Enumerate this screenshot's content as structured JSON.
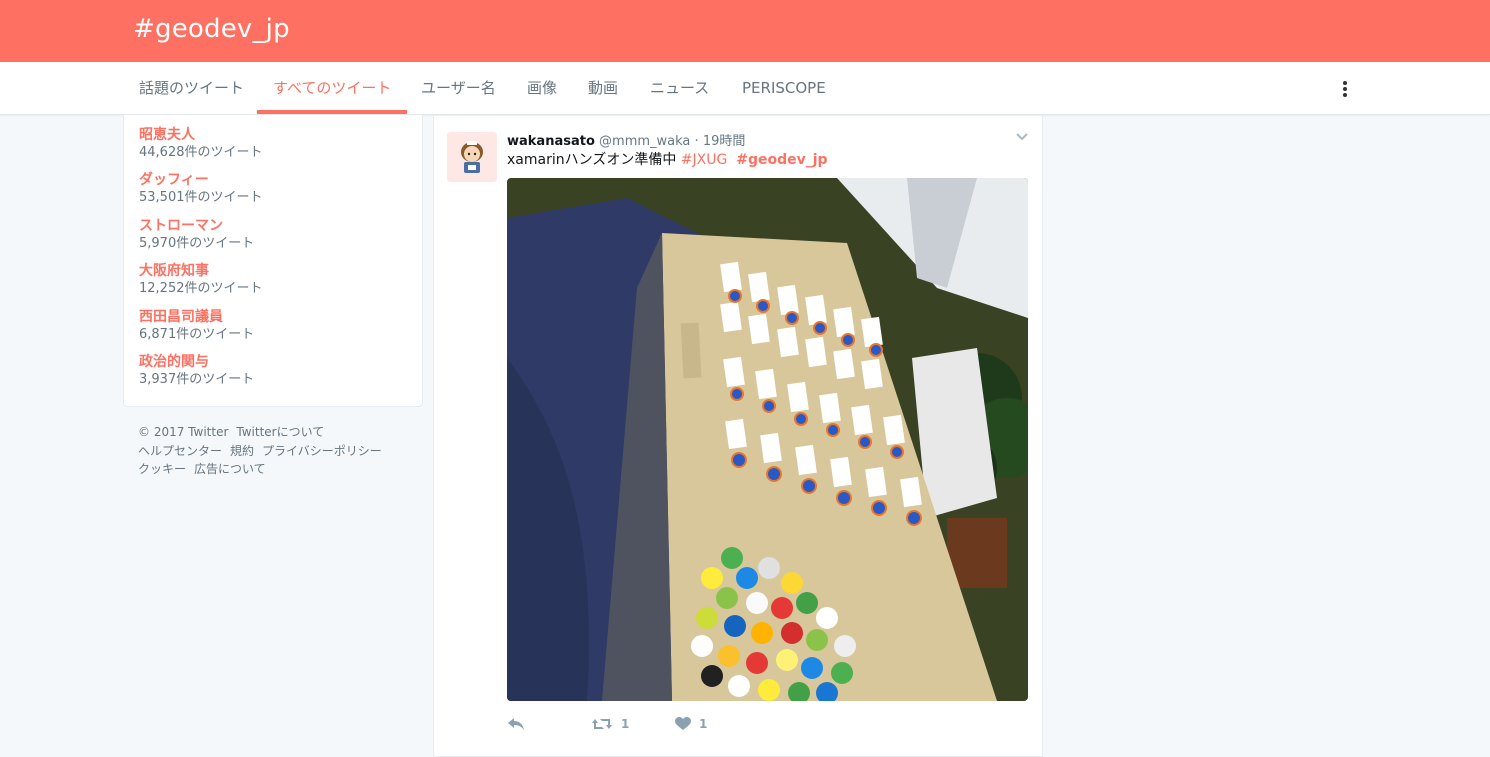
{
  "header": {
    "title": "#geodev_jp"
  },
  "nav": {
    "tabs": [
      {
        "label": "話題のツイート",
        "active": false
      },
      {
        "label": "すべてのツイート",
        "active": true
      },
      {
        "label": "ユーザー名",
        "active": false
      },
      {
        "label": "画像",
        "active": false
      },
      {
        "label": "動画",
        "active": false
      },
      {
        "label": "ニュース",
        "active": false
      },
      {
        "label": "PERISCOPE",
        "active": false
      }
    ]
  },
  "trends": [
    {
      "name": "昭恵夫人",
      "count": "44,628件のツイート"
    },
    {
      "name": "ダッフィー",
      "count": "53,501件のツイート"
    },
    {
      "name": "ストローマン",
      "count": "5,970件のツイート"
    },
    {
      "name": "大阪府知事",
      "count": "12,252件のツイート"
    },
    {
      "name": "西田昌司議員",
      "count": "6,871件のツイート"
    },
    {
      "name": "政治的関与",
      "count": "3,937件のツイート"
    }
  ],
  "footer": {
    "copyright": "© 2017 Twitter",
    "about": "Twitterについて",
    "help": "ヘルプセンター",
    "terms": "規約",
    "privacy": "プライバシーポリシー",
    "cookies": "クッキー",
    "ads": "広告について"
  },
  "tweet": {
    "username": "wakanasato",
    "handle": "@mmm_waka",
    "separator": "·",
    "time": "19時間",
    "text": "xamarinハンズオン準備中 ",
    "hashtag1": "#JXUG",
    "hashtag2": "#geodev_jp",
    "retweet_count": "1",
    "like_count": "1"
  },
  "colors": {
    "brand": "#fe7162",
    "muted_text": "#66757f",
    "background": "#f5f8fa"
  },
  "icons": [
    "kebab-menu-icon",
    "chevron-down-icon",
    "reply-icon",
    "retweet-icon",
    "heart-icon"
  ]
}
